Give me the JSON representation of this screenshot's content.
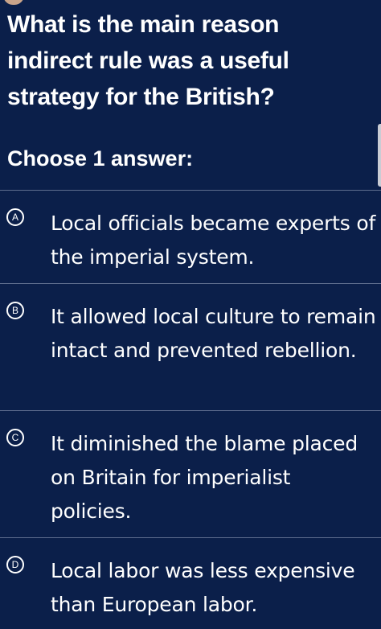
{
  "question": {
    "text": "What is the main reason indirect rule was a useful strategy for the British?"
  },
  "prompt": "Choose 1 answer:",
  "choices": [
    {
      "letter": "A",
      "text": "Local officials became experts of the imperial system."
    },
    {
      "letter": "B",
      "text": "It allowed local culture to remain intact and prevented rebellion."
    },
    {
      "letter": "C",
      "text": "It diminished the blame placed on Britain for imperialist policies."
    },
    {
      "letter": "D",
      "text": "Local labor was less expensive than European labor."
    }
  ],
  "colors": {
    "background": "#0b1f4a",
    "text": "#ffffff",
    "divider": "#5e6d8e",
    "scrollbar": "#c9ccd4"
  }
}
